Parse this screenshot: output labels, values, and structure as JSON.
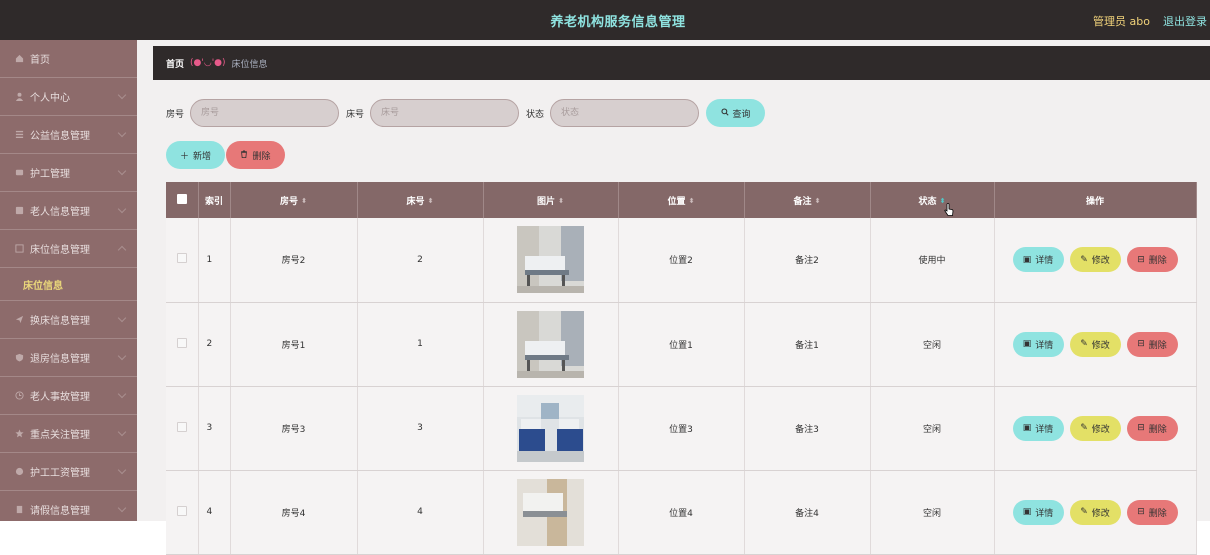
{
  "header": {
    "title": "养老机构服务信息管理",
    "admin": "管理员 abo",
    "logout": "退出登录"
  },
  "sidebar": {
    "items": [
      {
        "label": "首页",
        "icon": "home-icon",
        "chev": false
      },
      {
        "label": "个人中心",
        "icon": "user-icon",
        "chev": true
      },
      {
        "label": "公益信息管理",
        "icon": "list-icon",
        "chev": true
      },
      {
        "label": "护工管理",
        "icon": "nurse-icon",
        "chev": true
      },
      {
        "label": "老人信息管理",
        "icon": "elder-icon",
        "chev": true
      },
      {
        "label": "床位信息管理",
        "icon": "bed-icon",
        "chev": true
      }
    ],
    "sub_item": "床位信息",
    "items2": [
      {
        "label": "换床信息管理",
        "icon": "send-icon",
        "chev": true
      },
      {
        "label": "退房信息管理",
        "icon": "shield-icon",
        "chev": true
      },
      {
        "label": "老人事故管理",
        "icon": "clock-icon",
        "chev": true
      },
      {
        "label": "重点关注管理",
        "icon": "star-icon",
        "chev": true
      },
      {
        "label": "护工工资管理",
        "icon": "wallet-icon",
        "chev": true
      },
      {
        "label": "请假信息管理",
        "icon": "doc-icon",
        "chev": true
      }
    ]
  },
  "breadcrumb": {
    "home": "首页",
    "sep": "(●'◡'●)",
    "current": "床位信息"
  },
  "search": {
    "room_label": "房号",
    "room_placeholder": "房号",
    "bed_label": "床号",
    "bed_placeholder": "床号",
    "status_label": "状态",
    "status_placeholder": "状态",
    "query": "查询"
  },
  "actions": {
    "add": "新增",
    "delete": "删除"
  },
  "table": {
    "headers": {
      "index": "索引",
      "room": "房号",
      "bed": "床号",
      "image": "图片",
      "position": "位置",
      "note": "备注",
      "status": "状态",
      "ops": "操作"
    },
    "rows": [
      {
        "index": "1",
        "room": "房号2",
        "bed": "2",
        "position": "位置2",
        "note": "备注2",
        "status": "使用中"
      },
      {
        "index": "2",
        "room": "房号1",
        "bed": "1",
        "position": "位置1",
        "note": "备注1",
        "status": "空闲"
      },
      {
        "index": "3",
        "room": "房号3",
        "bed": "3",
        "position": "位置3",
        "note": "备注3",
        "status": "空闲"
      },
      {
        "index": "4",
        "room": "房号4",
        "bed": "4",
        "position": "位置4",
        "note": "备注4",
        "status": "空闲"
      }
    ],
    "ops": {
      "detail": "详情",
      "edit": "修改",
      "delete": "删除"
    }
  },
  "colors": {
    "accent": "#8fe3e0",
    "danger": "#e77878",
    "warn": "#e3e066",
    "sidebar": "#8d6b6b",
    "header": "#2f2a2a"
  }
}
